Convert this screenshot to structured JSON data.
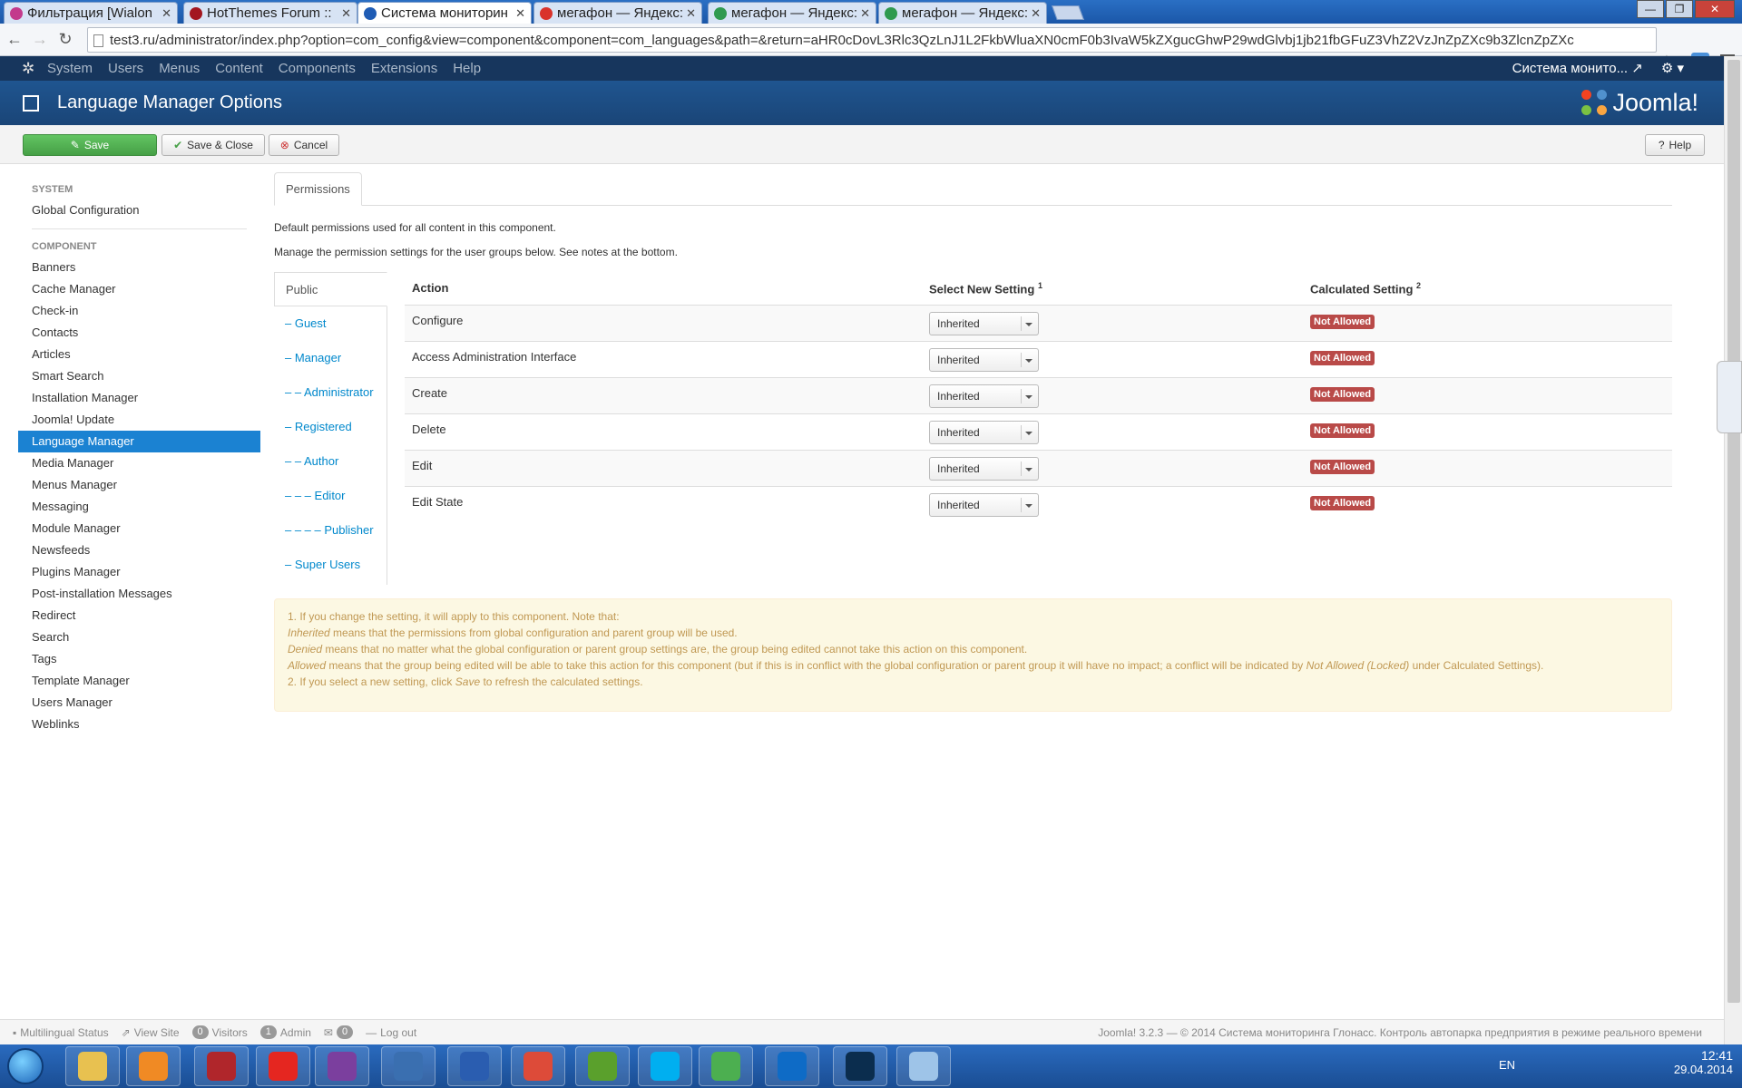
{
  "browser": {
    "tabs": [
      {
        "label": "Фильтрация [Wialon",
        "color": "#c33a8c",
        "active": false
      },
      {
        "label": "HotThemes Forum ::",
        "color": "#a3161f",
        "active": false
      },
      {
        "label": "Система мониторин",
        "color": "#1f5cb5",
        "active": true
      },
      {
        "label": "мегафон — Яндекс:",
        "color": "#d9332b",
        "active": false
      },
      {
        "label": "мегафон — Яндекс:",
        "color": "#2f9a4f",
        "active": false
      },
      {
        "label": "мегафон — Яндекс:",
        "color": "#2f9a4f",
        "active": false
      }
    ],
    "url": "test3.ru/administrator/index.php?option=com_config&view=component&component=com_languages&path=&return=aHR0cDovL3Rlc3QzLnJ1L2FkbWluaXN0cmF0b3IvaW5kZXgucGhwP29wdGlvbj1jb21fbGFuZ3VhZ2VzJnZpZXc9b3ZlcnZpZXc"
  },
  "joomla_nav": {
    "items": [
      "System",
      "Users",
      "Menus",
      "Content",
      "Components",
      "Extensions",
      "Help"
    ],
    "site_link": "Система монито... ↗",
    "settings": "⚙ ▾"
  },
  "title": {
    "text": "Language Manager Options",
    "brand": "Joomla!"
  },
  "toolbar": {
    "save": "Save",
    "save_close": "Save & Close",
    "cancel": "Cancel",
    "help": "Help"
  },
  "sidebar": {
    "system_header": "SYSTEM",
    "global_config": "Global Configuration",
    "component_header": "COMPONENT",
    "items": [
      "Banners",
      "Cache Manager",
      "Check-in",
      "Contacts",
      "Articles",
      "Smart Search",
      "Installation Manager",
      "Joomla! Update",
      "Language Manager",
      "Media Manager",
      "Menus Manager",
      "Messaging",
      "Module Manager",
      "Newsfeeds",
      "Plugins Manager",
      "Post-installation Messages",
      "Redirect",
      "Search",
      "Tags",
      "Template Manager",
      "Users Manager",
      "Weblinks"
    ],
    "active_index": 8
  },
  "main": {
    "tab": "Permissions",
    "desc1": "Default permissions used for all content in this component.",
    "desc2": "Manage the permission settings for the user groups below. See notes at the bottom.",
    "groups": [
      "Public",
      "– Guest",
      "– Manager",
      "– – Administrator",
      "– Registered",
      "– – Author",
      "– – – Editor",
      "– – – – Publisher",
      "– Super Users"
    ],
    "table": {
      "col_action": "Action",
      "col_select": "Select New Setting",
      "col_select_sup": "1",
      "col_calc": "Calculated Setting",
      "col_calc_sup": "2",
      "rows": [
        {
          "action": "Configure",
          "setting": "Inherited",
          "calc": "Not Allowed"
        },
        {
          "action": "Access Administration Interface",
          "setting": "Inherited",
          "calc": "Not Allowed"
        },
        {
          "action": "Create",
          "setting": "Inherited",
          "calc": "Not Allowed"
        },
        {
          "action": "Delete",
          "setting": "Inherited",
          "calc": "Not Allowed"
        },
        {
          "action": "Edit",
          "setting": "Inherited",
          "calc": "Not Allowed"
        },
        {
          "action": "Edit State",
          "setting": "Inherited",
          "calc": "Not Allowed"
        }
      ]
    },
    "notes": {
      "n1": "1. If you change the setting, it will apply to this component. Note that:",
      "inherited_em": "Inherited",
      "inherited_rest": " means that the permissions from global configuration and parent group will be used.",
      "denied_em": "Denied",
      "denied_rest": " means that no matter what the global configuration or parent group settings are, the group being edited cannot take this action on this component.",
      "allowed_em": "Allowed",
      "allowed_rest": " means that the group being edited will be able to take this action for this component (but if this is in conflict with the global configuration or parent group it will have no impact; a conflict will be indicated by ",
      "locked_em": "Not Allowed (Locked)",
      "allowed_tail": " under Calculated Settings).",
      "n2_pre": "2. If you select a new setting, click ",
      "n2_em": "Save",
      "n2_post": " to refresh the calculated settings."
    }
  },
  "statusbar": {
    "multilingual": "Multilingual Status",
    "view_site": "View Site",
    "visitors_count": "0",
    "visitors": "Visitors",
    "admin_count": "1",
    "admin": "Admin",
    "msg_count": "0",
    "logout": "Log out",
    "footer": "Joomla! 3.2.3 — © 2014 Система мониторинга Глонасс. Контроль автопарка предприятия в режиме реального времени"
  },
  "taskbar": {
    "lang": "EN",
    "time": "12:41",
    "date": "29.04.2014",
    "apps": [
      {
        "name": "explorer",
        "color": "#e8c150"
      },
      {
        "name": "media-player",
        "color": "#f08a24"
      },
      {
        "name": "antivirus",
        "color": "#b0262b"
      },
      {
        "name": "yandex-browser",
        "color": "#e52620"
      },
      {
        "name": "onenote",
        "color": "#7b3f9e"
      },
      {
        "name": "thunderbird",
        "color": "#3a6fb0"
      },
      {
        "name": "floppy-app",
        "color": "#2a5db0"
      },
      {
        "name": "chrome",
        "color": "#dd4b39"
      },
      {
        "name": "utorrent",
        "color": "#5aa02c"
      },
      {
        "name": "skype",
        "color": "#00aff0"
      },
      {
        "name": "icq",
        "color": "#4caf50"
      },
      {
        "name": "teamviewer",
        "color": "#0e6bc6"
      },
      {
        "name": "photoshop",
        "color": "#0b2d4e"
      },
      {
        "name": "paint",
        "color": "#9ec4e8"
      }
    ]
  }
}
